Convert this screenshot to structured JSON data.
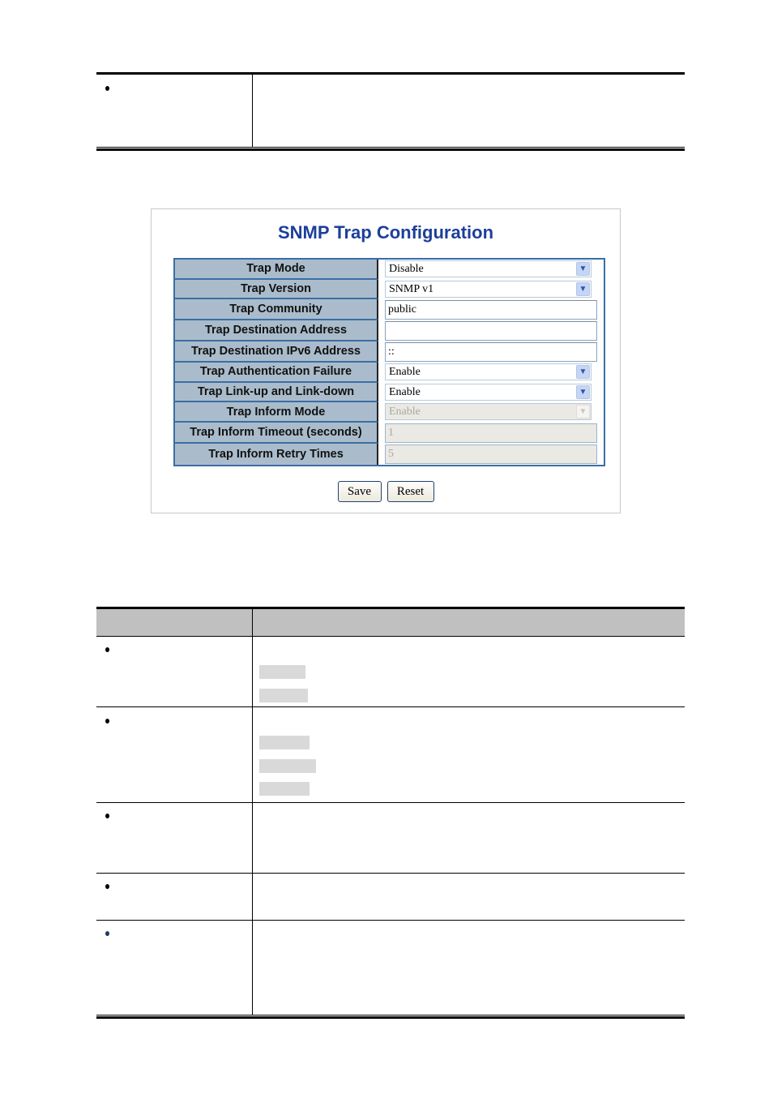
{
  "top_table": {
    "rows": [
      {
        "bullet": "•",
        "description": ""
      }
    ]
  },
  "screenshot": {
    "title": "SNMP Trap Configuration",
    "fields": [
      {
        "label": "Trap Mode",
        "type": "select",
        "value": "Disable",
        "disabled": false
      },
      {
        "label": "Trap Version",
        "type": "select",
        "value": "SNMP v1",
        "disabled": false
      },
      {
        "label": "Trap Community",
        "type": "text",
        "value": "public",
        "disabled": false
      },
      {
        "label": "Trap Destination Address",
        "type": "text",
        "value": "",
        "disabled": false
      },
      {
        "label": "Trap Destination IPv6 Address",
        "type": "text",
        "value": "::",
        "disabled": false
      },
      {
        "label": "Trap Authentication Failure",
        "type": "select",
        "value": "Enable",
        "disabled": false
      },
      {
        "label": "Trap Link-up and Link-down",
        "type": "select",
        "value": "Enable",
        "disabled": false
      },
      {
        "label": "Trap Inform Mode",
        "type": "select",
        "value": "Enable",
        "disabled": true
      },
      {
        "label": "Trap Inform Timeout (seconds)",
        "type": "text",
        "value": "1",
        "disabled": true
      },
      {
        "label": "Trap Inform Retry Times",
        "type": "text",
        "value": "5",
        "disabled": true
      }
    ],
    "buttons": {
      "save": "Save",
      "reset": "Reset"
    },
    "arrow_glyph": "⌄"
  },
  "bottom_table": {
    "header": {
      "object": "",
      "description": ""
    },
    "rows": [
      {
        "bullet": "•",
        "swatches": 2
      },
      {
        "bullet": "•",
        "swatches": 3
      },
      {
        "bullet": "•",
        "swatches": 0
      },
      {
        "bullet": "•",
        "swatches": 0
      },
      {
        "bullet": "•",
        "swatches": 0
      }
    ]
  },
  "colors": {
    "title": "#1d3f9a",
    "label_bg": "#aabccb",
    "table_border": "#3b6ea5",
    "header_bg": "#c0c0c0",
    "swatch": "#d9d9d9"
  }
}
